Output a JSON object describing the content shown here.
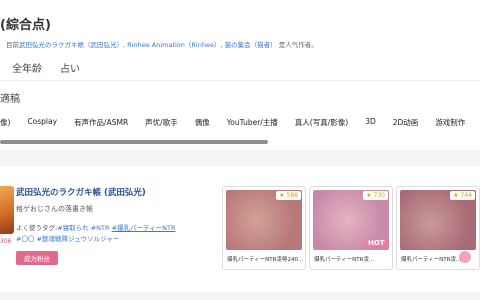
{
  "header": {
    "title": "(綜合点)",
    "subtitle_prefix": "目前",
    "subtitle_links": [
      "武田弘光のラクガキ帳（武田弘光）",
      "Rinhee Animation（Rinhee）",
      "猫の集会（猫者）"
    ],
    "subtitle_suffix": "是人气作者。",
    "age_tabs": [
      "全年龄",
      "占い"
    ]
  },
  "section": {
    "label": "適稿",
    "categories": [
      "像)",
      "Cosplay",
      "有声作品/ASMR",
      "声优/歌手",
      "偶像",
      "YouTuber/主播",
      "真人(写真/影像)",
      "3D",
      "2D动画",
      "游戏制作"
    ]
  },
  "creator": {
    "name": "武田弘光のラクガキ帳 (武田弘光)",
    "description": "格ゲおじさんの落書き帳",
    "tags_prefix": "よく使うタグ:",
    "tags": [
      "#寝取られ",
      "#NTR",
      "#爆乳パーティーNTR",
      "#〇〇",
      "#獣魂戦隊ジュウソルジャー"
    ],
    "avatar_number": "306",
    "support_label": "成为粉丝"
  },
  "thumbnails": [
    {
      "likes": "588",
      "caption": "爆乳パーティーNTR凌辱240...",
      "color": "#d4a196",
      "color2": "#b8787a",
      "hot": false
    },
    {
      "likes": "730",
      "caption": "爆乳パーティーNTR凌...",
      "color": "#e6b4c2",
      "color2": "#c88aa8",
      "hot": true,
      "hot_label": "HOT"
    },
    {
      "likes": "744",
      "caption": "爆乳パーティーNTR凌...",
      "color": "#c99a9a",
      "color2": "#a96a76",
      "hot": false
    }
  ]
}
